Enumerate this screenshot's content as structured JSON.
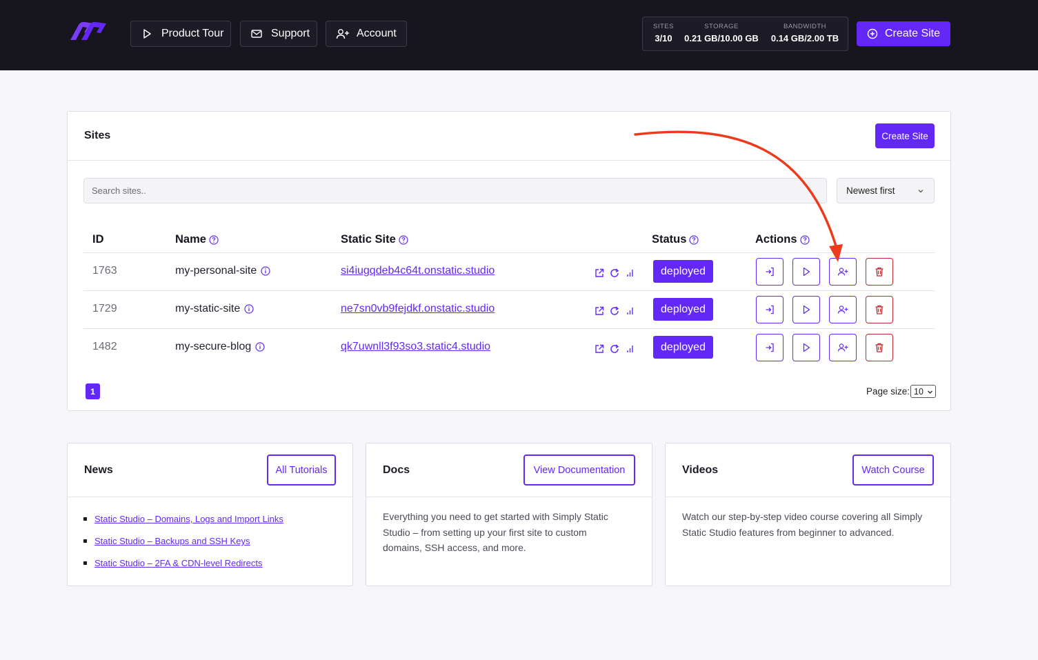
{
  "topbar": {
    "nav": [
      {
        "label": "Product Tour",
        "icon": "play-icon"
      },
      {
        "label": "Support",
        "icon": "mail-icon"
      },
      {
        "label": "Account",
        "icon": "user-plus-icon"
      }
    ],
    "stats": [
      {
        "label": "SITES",
        "value": "3/10"
      },
      {
        "label": "STORAGE",
        "value": "0.21 GB/10.00 GB"
      },
      {
        "label": "BANDWIDTH",
        "value": "0.14 GB/2.00 TB"
      }
    ],
    "create_label": "Create Site"
  },
  "sites": {
    "title": "Sites",
    "create_label": "Create Site",
    "search_placeholder": "Search sites..",
    "sort_value": "Newest first",
    "columns": {
      "id": "ID",
      "name": "Name",
      "static_site": "Static Site",
      "status": "Status",
      "actions": "Actions"
    },
    "rows": [
      {
        "id": "1763",
        "name": "my-personal-site",
        "url": "si4iugqdeb4c64t.onstatic.studio",
        "status": "deployed"
      },
      {
        "id": "1729",
        "name": "my-static-site",
        "url": "ne7sn0vb9fejdkf.onstatic.studio",
        "status": "deployed"
      },
      {
        "id": "1482",
        "name": "my-secure-blog",
        "url": "qk7uwnll3f93so3.static4.studio",
        "status": "deployed"
      }
    ],
    "page": "1",
    "page_size_label": "Page size:",
    "page_size": "10"
  },
  "news": {
    "title": "News",
    "button": "All Tutorials",
    "items": [
      "Static Studio – Domains, Logs and Import Links",
      "Static Studio – Backups and SSH Keys",
      "Static Studio – 2FA & CDN-level Redirects"
    ]
  },
  "docs": {
    "title": "Docs",
    "button": "View Documentation",
    "text_lines": [
      "Everything you need to get started with Simply Static",
      "Studio – from setting up your first site to custom",
      "domains, SSH access, and more."
    ]
  },
  "videos": {
    "title": "Videos",
    "button": "Watch Course",
    "text_lines": [
      "Watch our step-by-step video course covering all Simply",
      "Static Studio features from beginner to advanced."
    ]
  },
  "colors": {
    "accent": "#6328f5",
    "danger": "#c0282c",
    "topbar": "#17161f",
    "annotation": "#ee3a1c"
  }
}
